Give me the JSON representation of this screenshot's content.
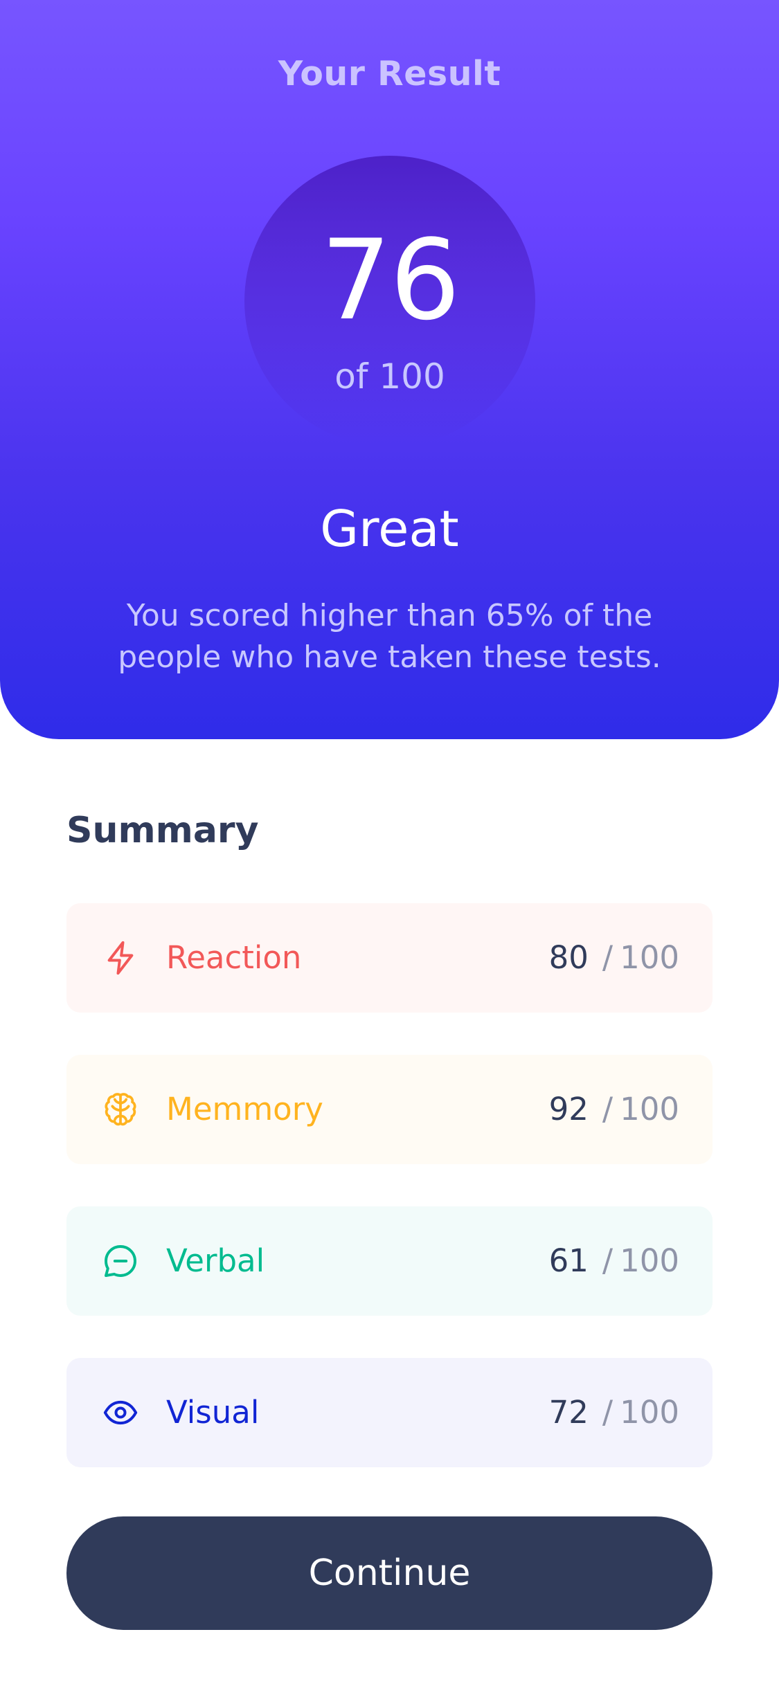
{
  "result": {
    "heading": "Your Result",
    "score": "76",
    "score_max": "of 100",
    "rating": "Great",
    "message": "You scored higher than 65% of the people who have taken these tests."
  },
  "summary": {
    "title": "Summary",
    "items": [
      {
        "label": "Reaction",
        "value": "80",
        "separator": "/",
        "max": "100",
        "icon": "lightning-icon",
        "color": "#f25858",
        "background": "#fff6f5"
      },
      {
        "label": "Memmory",
        "value": "92",
        "separator": "/",
        "max": "100",
        "icon": "brain-icon",
        "color": "#ffb31f",
        "background": "#fffbf4"
      },
      {
        "label": "Verbal",
        "value": "61",
        "separator": "/",
        "max": "100",
        "icon": "chat-bubble-icon",
        "color": "#00bb8f",
        "background": "#f2fbfa"
      },
      {
        "label": "Visual",
        "value": "72",
        "separator": "/",
        "max": "100",
        "icon": "eye-icon",
        "color": "#1125d4",
        "background": "#f3f3fd"
      }
    ]
  },
  "continue_label": "Continue",
  "colors": {
    "gradient_top": "#7755ff",
    "gradient_bottom": "#2f2ce9",
    "dark_navy": "#303b5a"
  }
}
